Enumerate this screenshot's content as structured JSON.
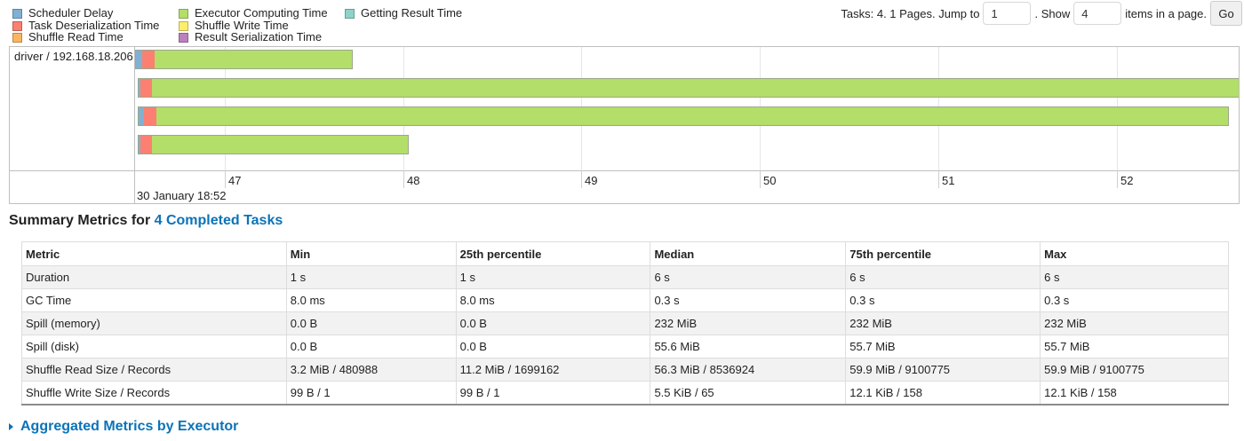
{
  "legend": {
    "items": [
      {
        "label": "Scheduler Delay",
        "color": "#80b1d3"
      },
      {
        "label": "Task Deserialization Time",
        "color": "#fb8072"
      },
      {
        "label": "Shuffle Read Time",
        "color": "#fdb462"
      },
      {
        "label": "Executor Computing Time",
        "color": "#b3de69"
      },
      {
        "label": "Shuffle Write Time",
        "color": "#ffed6f"
      },
      {
        "label": "Result Serialization Time",
        "color": "#bc80bd"
      },
      {
        "label": "Getting Result Time",
        "color": "#8dd3c7"
      }
    ]
  },
  "pager": {
    "text_before": "Tasks: 4. 1 Pages. Jump to",
    "page_value": "1",
    "text_middle": ". Show",
    "page_size_value": "4",
    "text_after": "items in a page.",
    "go_label": "Go"
  },
  "timeline": {
    "executor_label": "driver / 192.168.18.206",
    "date_label": "30 January 18:52",
    "ticks": [
      "47",
      "48",
      "49",
      "50",
      "51",
      "52"
    ]
  },
  "summary": {
    "title_prefix": "Summary Metrics for ",
    "title_link": "4 Completed Tasks",
    "columns": [
      "Metric",
      "Min",
      "25th percentile",
      "Median",
      "75th percentile",
      "Max"
    ],
    "rows": [
      [
        "Duration",
        "1 s",
        "1 s",
        "6 s",
        "6 s",
        "6 s"
      ],
      [
        "GC Time",
        "8.0 ms",
        "8.0 ms",
        "0.3 s",
        "0.3 s",
        "0.3 s"
      ],
      [
        "Spill (memory)",
        "0.0 B",
        "0.0 B",
        "232 MiB",
        "232 MiB",
        "232 MiB"
      ],
      [
        "Spill (disk)",
        "0.0 B",
        "0.0 B",
        "55.6 MiB",
        "55.7 MiB",
        "55.7 MiB"
      ],
      [
        "Shuffle Read Size / Records",
        "3.2 MiB / 480988",
        "11.2 MiB / 1699162",
        "56.3 MiB / 8536924",
        "59.9 MiB / 9100775",
        "59.9 MiB / 9100775"
      ],
      [
        "Shuffle Write Size / Records",
        "99 B / 1",
        "99 B / 1",
        "5.5 KiB / 65",
        "12.1 KiB / 158",
        "12.1 KiB / 158"
      ]
    ]
  },
  "aggregated": {
    "label": "Aggregated Metrics by Executor"
  }
}
